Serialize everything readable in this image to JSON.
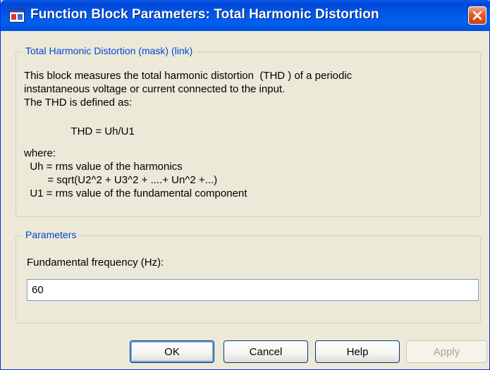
{
  "window": {
    "title": "Function Block Parameters: Total Harmonic Distortion"
  },
  "description_group": {
    "legend": "Total Harmonic Distortion (mask) (link)",
    "lines": [
      "This block measures the total harmonic distortion  (THD ) of a periodic",
      "instantaneous voltage or current connected to the input.",
      "The THD is defined as:",
      "                THD = Uh/U1",
      "where:",
      "  Uh = rms value of the harmonics",
      "        = sqrt(U2^2 + U3^2 + ....+ Un^2 +...)",
      "  U1 = rms value of the fundamental component"
    ]
  },
  "parameters_group": {
    "legend": "Parameters",
    "frequency_label": "Fundamental frequency (Hz):",
    "frequency_value": "60"
  },
  "buttons": {
    "ok": "OK",
    "cancel": "Cancel",
    "help": "Help",
    "apply": "Apply"
  },
  "icons": {
    "app": "simulink-block-icon",
    "close": "close-icon"
  },
  "colors": {
    "titlebar": "#0055e5",
    "legend_text": "#0046d5",
    "dialog_bg": "#ece9d8",
    "close_button": "#e25a2e"
  }
}
